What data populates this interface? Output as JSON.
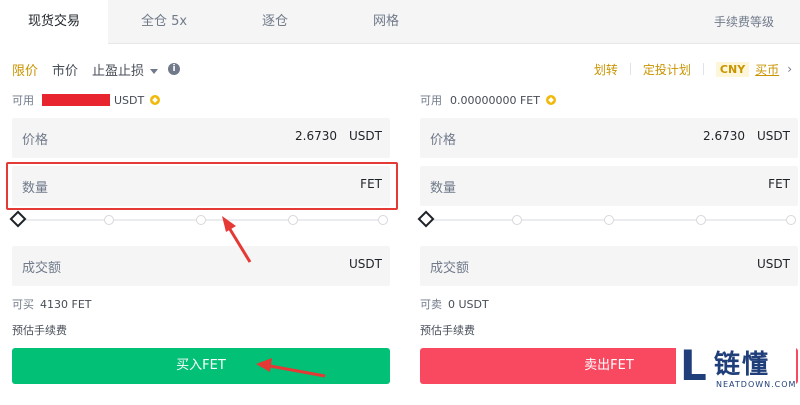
{
  "tabs": [
    {
      "label": "现货交易",
      "active": true
    },
    {
      "label": "全仓 5x",
      "active": false
    },
    {
      "label": "逐仓",
      "active": false
    },
    {
      "label": "网格",
      "active": false
    }
  ],
  "fee_level_label": "手续费等级",
  "order_types": {
    "limit": "限价",
    "market": "市价",
    "stop": "止盈止损"
  },
  "right_links": {
    "transfer": "划转",
    "auto_invest": "定投计划",
    "currency": "CNY",
    "buy_coin": "买币"
  },
  "buy_panel": {
    "available_label": "可用",
    "available_unit": "USDT",
    "price_label": "价格",
    "price_value": "2.6730",
    "price_unit": "USDT",
    "amount_label": "数量",
    "amount_unit": "FET",
    "total_label": "成交额",
    "total_unit": "USDT",
    "max_label": "可买",
    "max_value": "4130 FET",
    "fee_label": "预估手续费",
    "button": "买入FET"
  },
  "sell_panel": {
    "available_label": "可用",
    "available_value": "0.00000000 FET",
    "price_label": "价格",
    "price_value": "2.6730",
    "price_unit": "USDT",
    "amount_label": "数量",
    "amount_unit": "FET",
    "total_label": "成交额",
    "total_unit": "USDT",
    "max_label": "可卖",
    "max_value": "0 USDT",
    "fee_label": "预估手续费",
    "button": "卖出FET"
  },
  "watermark": {
    "letter": "L",
    "cn": "链懂",
    "en": "NEATDOWN.COM"
  },
  "colors": {
    "accent": "#c99400",
    "buy": "#02c076",
    "sell": "#f84960",
    "annotation": "#e53935"
  }
}
